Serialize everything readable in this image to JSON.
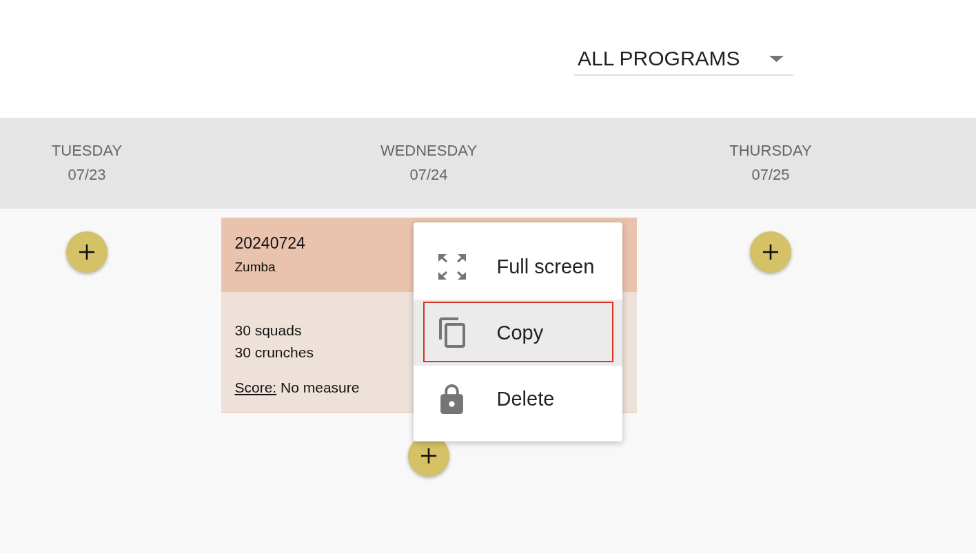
{
  "program_filter": {
    "value": "ALL PROGRAMS"
  },
  "days": [
    {
      "name": "TUESDAY",
      "date": "07/23"
    },
    {
      "name": "WEDNESDAY",
      "date": "07/24",
      "workouts": [
        {
          "title": "20240724",
          "program": "Zumba",
          "exercises": [
            "30 squads",
            "30 crunches"
          ],
          "score_label": "Score:",
          "score": "No measure",
          "menu": {
            "items": [
              {
                "kind": "fullscreen",
                "label": "Full screen",
                "selected": false,
                "outlined": false
              },
              {
                "kind": "copy",
                "label": "Copy",
                "selected": true,
                "outlined": true
              },
              {
                "kind": "delete",
                "label": "Delete",
                "selected": false,
                "outlined": false
              }
            ]
          }
        }
      ]
    },
    {
      "name": "THURSDAY",
      "date": "07/25"
    }
  ]
}
